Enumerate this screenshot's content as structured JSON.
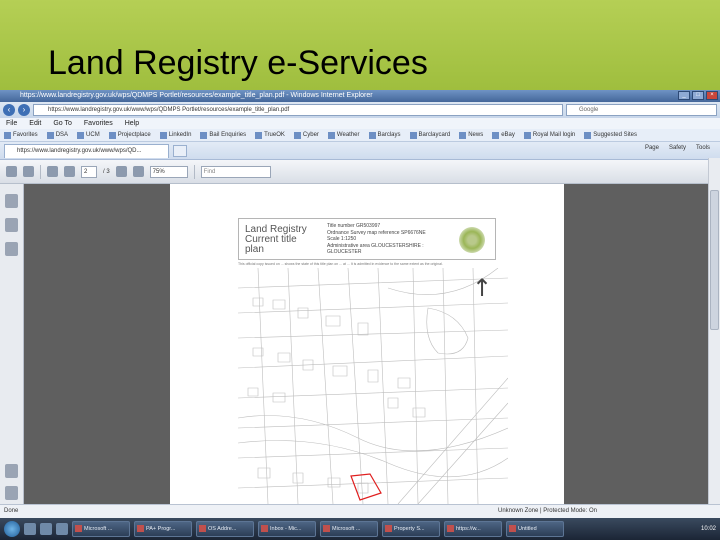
{
  "slide": {
    "title": "Land Registry e-Services"
  },
  "browser": {
    "window_title": "https://www.landregistry.gov.uk/wps/QDMPS Portlet/resources/example_title_plan.pdf - Windows Internet Explorer",
    "address": "https://www.landregistry.gov.uk/www/wps/QDMPS Portlet/resources/example_title_plan.pdf",
    "search_placeholder": "Google",
    "menu": [
      "File",
      "Edit",
      "Go To",
      "Favorites",
      "Help"
    ],
    "favorites": [
      "Favorites",
      "DSA",
      "UCM",
      "Projectplace",
      "LinkedIn",
      "Bail Enquiries",
      "TrueOK",
      "Cyber",
      "Weather",
      "Barclays",
      "Barclaycard",
      "News",
      "eBay",
      "Royal Mail login",
      "Suggested Sites"
    ],
    "tab_label": "https://www.landregistry.gov.uk/www/wps/QD...",
    "command_bar": [
      "Page",
      "Safety",
      "Tools"
    ]
  },
  "pdf_toolbar": {
    "page_current": "2",
    "page_total": "/ 3",
    "zoom": "75%",
    "find_placeholder": "Find"
  },
  "document": {
    "header_title": "Land Registry Current title plan",
    "info_lines": [
      "Title number GR503997",
      "Ordnance Survey map reference SP6676NE",
      "Scale 1:1250",
      "Administrative area GLOUCESTERSHIRE :",
      "GLOUCESTER"
    ],
    "footnote": "This official copy issued on ... shows the state of this title plan on ... at ... It is admitted in evidence to the same extent as the original."
  },
  "status": {
    "left": "Done",
    "right": "Unknown Zone | Protected Mode: On"
  },
  "taskbar": {
    "tasks": [
      "Microsoft ...",
      "PA+ Progr...",
      "OS Addre...",
      "Inbox - Mic...",
      "Microsoft ...",
      "Property S...",
      "https://w...",
      "Untitled"
    ],
    "clock": "10:02"
  }
}
